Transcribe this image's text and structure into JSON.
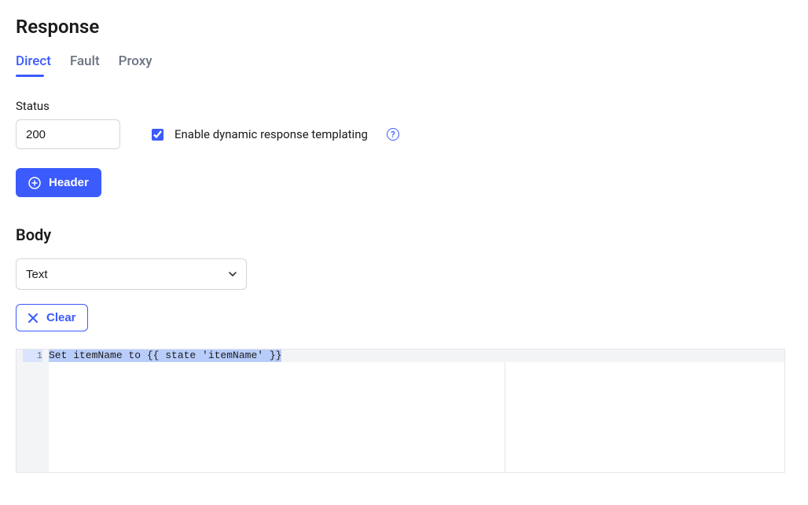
{
  "section": {
    "title": "Response"
  },
  "tabs": {
    "direct": "Direct",
    "fault": "Fault",
    "proxy": "Proxy"
  },
  "status": {
    "label": "Status",
    "value": "200"
  },
  "templating": {
    "label": "Enable dynamic response templating",
    "checked": true
  },
  "headerButton": {
    "label": "Header"
  },
  "body": {
    "title": "Body",
    "typeSelected": "Text",
    "clearLabel": "Clear"
  },
  "editor": {
    "lineNumber": "1",
    "content": "Set itemName to {{ state 'itemName' }}"
  }
}
